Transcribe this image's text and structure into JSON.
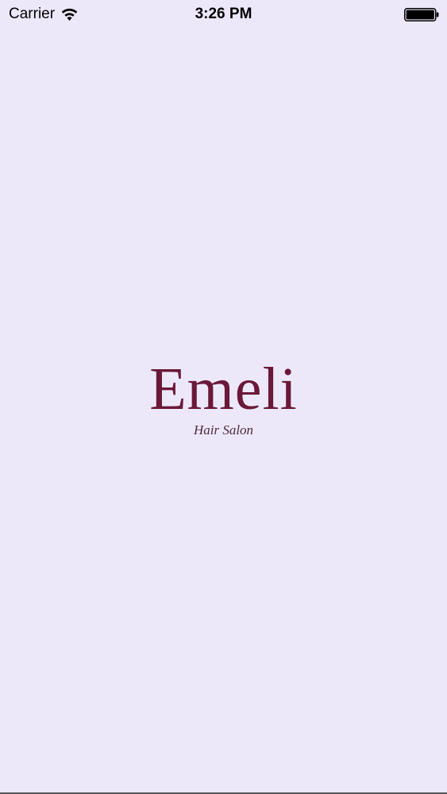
{
  "status_bar": {
    "carrier": "Carrier",
    "time": "3:26 PM",
    "wifi_icon": "wifi-icon",
    "battery_icon": "battery-icon"
  },
  "splash": {
    "wordmark": "Emeli",
    "tagline": "Hair Salon"
  },
  "colors": {
    "background": "#ECE8FA",
    "brand": "#6A1838"
  }
}
